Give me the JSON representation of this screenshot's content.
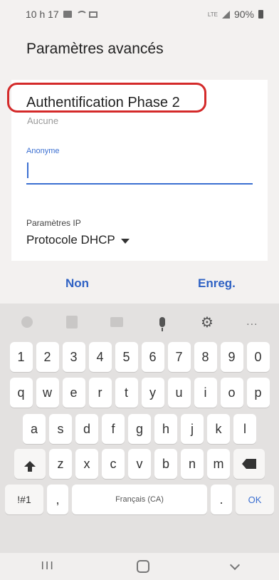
{
  "status_bar": {
    "time": "10 h 17",
    "network": "LTE",
    "battery": "90%"
  },
  "screen": {
    "title": "Paramètres avancés"
  },
  "dialog": {
    "field_title": "Authentification Phase 2",
    "field_value": "Aucune",
    "input_label": "Anonyme",
    "input_value": "",
    "ip_label": "Paramètres IP",
    "ip_value": "Protocole DHCP"
  },
  "actions": {
    "cancel_label": "Non",
    "save_label": "Enreg."
  },
  "keyboard": {
    "toolbar_more": "...",
    "number_row": [
      "1",
      "2",
      "3",
      "4",
      "5",
      "6",
      "7",
      "8",
      "9",
      "0"
    ],
    "row_q": [
      "q",
      "w",
      "e",
      "r",
      "t",
      "y",
      "u",
      "i",
      "o",
      "p"
    ],
    "row_a": [
      "a",
      "s",
      "d",
      "f",
      "g",
      "h",
      "j",
      "k",
      "l"
    ],
    "row_z": [
      "z",
      "x",
      "c",
      "v",
      "b",
      "n",
      "m"
    ],
    "symbols_label": "!#1",
    "comma_label": ",",
    "space_label": "Français (CA)",
    "period_label": ".",
    "ok_label": "OK"
  },
  "nav_bar": {
    "recent_label": "III"
  },
  "colors": {
    "accent": "#3b6fd1",
    "action_text": "#2f62c4",
    "highlight": "#d42a2a"
  }
}
